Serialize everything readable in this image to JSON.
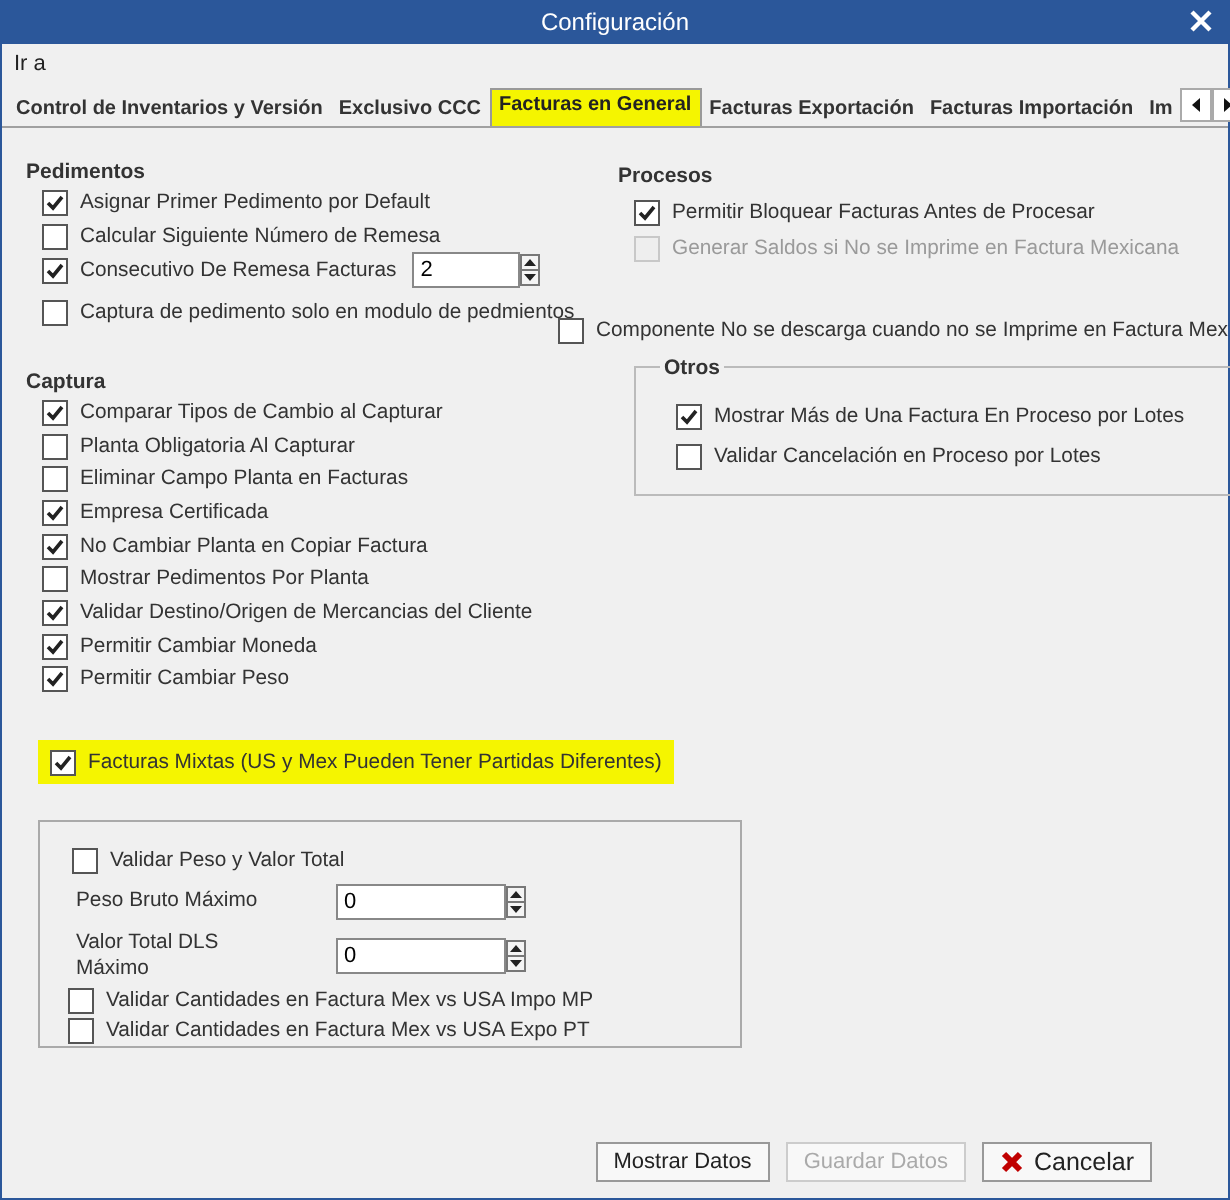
{
  "window": {
    "title": "Configuración"
  },
  "menu": [
    {
      "label": "Ir a"
    }
  ],
  "tabs": [
    {
      "label": "Control de Inventarios y Versión",
      "selected": false
    },
    {
      "label": "Exclusivo CCC",
      "selected": false
    },
    {
      "label": "Facturas en General",
      "selected": true
    },
    {
      "label": "Facturas Exportación",
      "selected": false
    },
    {
      "label": "Facturas Importación",
      "selected": false
    },
    {
      "label": "Im",
      "selected": false
    }
  ],
  "pedimentos": {
    "title": "Pedimentos",
    "items": [
      {
        "kind": "check",
        "label": "Asignar Primer Pedimento por Default",
        "checked": true
      },
      {
        "kind": "check",
        "label": "Calcular Siguiente Número de Remesa",
        "checked": false
      },
      {
        "kind": "spin",
        "label": "Consecutivo De Remesa Facturas",
        "checked": true,
        "value": "2"
      },
      {
        "kind": "check",
        "label": "Captura de pedimento solo en modulo de pedmientos",
        "checked": false
      }
    ]
  },
  "captura": {
    "title": "Captura",
    "items": [
      {
        "label": "Comparar Tipos de Cambio al Capturar",
        "checked": true
      },
      {
        "label": "Planta Obligatoria Al Capturar",
        "checked": false
      },
      {
        "label": "Eliminar Campo Planta en Facturas",
        "checked": false
      },
      {
        "label": "Empresa Certificada",
        "checked": true
      },
      {
        "label": "No Cambiar Planta en Copiar Factura",
        "checked": true
      },
      {
        "label": "Mostrar Pedimentos Por Planta",
        "checked": false
      },
      {
        "label": "Validar Destino/Origen de Mercancias del Cliente",
        "checked": true
      },
      {
        "label": "Permitir Cambiar Moneda",
        "checked": true
      },
      {
        "label": "Permitir Cambiar Peso",
        "checked": true
      }
    ]
  },
  "mixtas": {
    "label": "Facturas Mixtas (US y Mex Pueden Tener Partidas Diferentes)",
    "checked": true,
    "highlighted": true
  },
  "procesos": {
    "title": "Procesos",
    "items": [
      {
        "label": "Permitir Bloquear Facturas Antes de Procesar",
        "checked": true,
        "disabled": false
      },
      {
        "label": "Generar Saldos si No se Imprime en Factura Mexicana",
        "checked": false,
        "disabled": true
      }
    ]
  },
  "componente": {
    "label": "Componente No se descarga cuando no se Imprime en Factura Mex",
    "checked": false
  },
  "otros": {
    "title": "Otros",
    "items": [
      {
        "label": "Mostrar Más de Una Factura En Proceso por Lotes",
        "checked": true
      },
      {
        "label": "Validar Cancelación en Proceso por Lotes",
        "checked": false
      }
    ]
  },
  "validacion": {
    "check": {
      "label": "Validar Peso y Valor Total",
      "checked": false
    },
    "fields": [
      {
        "label": "Peso Bruto Máximo",
        "value": "0"
      },
      {
        "label": "Valor Total DLS Máximo",
        "value": "0"
      }
    ],
    "checks": [
      {
        "label": "Validar Cantidades en Factura Mex vs USA Impo MP",
        "checked": false
      },
      {
        "label": "Validar Cantidades en Factura Mex vs USA Expo PT",
        "checked": false
      }
    ]
  },
  "buttons": [
    {
      "kind": "plain",
      "label": "Mostrar Datos",
      "disabled": false
    },
    {
      "kind": "plain",
      "label": "Guardar Datos",
      "disabled": true
    },
    {
      "kind": "cancel",
      "label": "Cancelar",
      "disabled": false
    }
  ]
}
